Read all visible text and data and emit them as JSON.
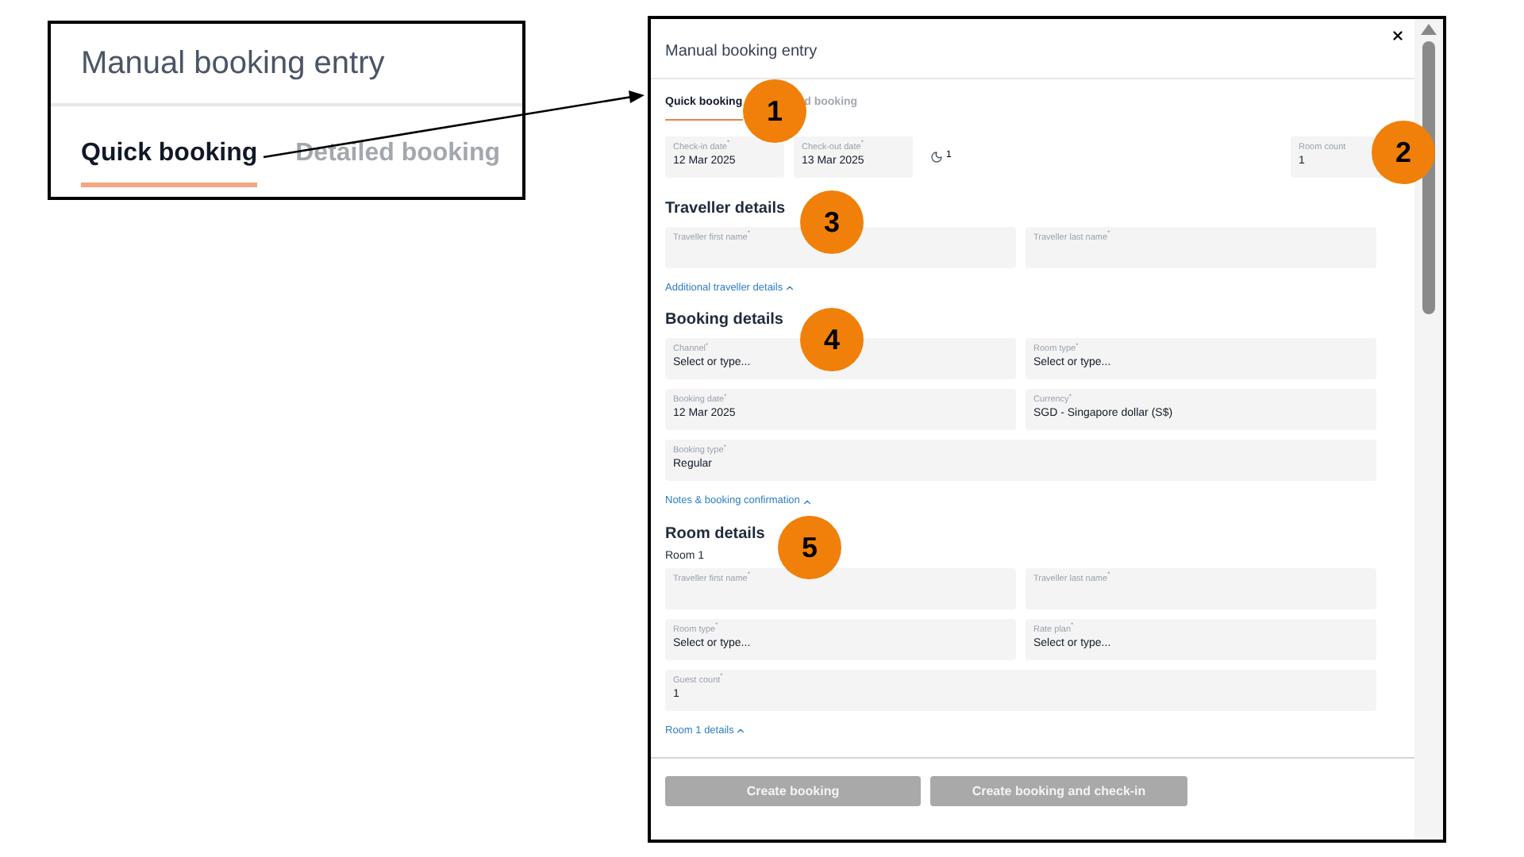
{
  "inset": {
    "title": "Manual booking entry",
    "tabs": [
      {
        "label": "Quick booking",
        "selected": true
      },
      {
        "label": "Detailed booking",
        "selected": false
      }
    ]
  },
  "dialog": {
    "title": "Manual booking entry",
    "tabs": [
      {
        "label": "Quick booking",
        "selected": true
      },
      {
        "label": "d booking",
        "selected": false
      }
    ],
    "stay_fields": [
      {
        "label": "Check-in date$^{*}$",
        "value": "12 Mar 2025"
      },
      {
        "label": "Check-out date$^{*}$",
        "value": "13 Mar 2025"
      }
    ],
    "nights": "1",
    "room_count": {
      "label": "Room count",
      "value": "1"
    },
    "sections": [
      {
        "heading": "Traveller details",
        "rows": [
          [
            {
              "label": "Traveller first name$^{*}$"
            },
            {
              "label": "Traveller last name$^{*}$"
            }
          ]
        ],
        "link": "Additional traveller details"
      },
      {
        "heading": "Booking details",
        "rows": [
          [
            {
              "label": "Channel$^{*}$",
              "value": "Select or type..."
            },
            {
              "label": "Room type$^{*}$",
              "value": "Select or type..."
            }
          ],
          [
            {
              "label": "Booking date$^{*}$",
              "value": "12 Mar 2025"
            },
            {
              "label": "Currency$^{*}$",
              "value": "SGD - Singapore dollar (S$)"
            }
          ],
          [
            {
              "label": "Booking type$^{*}$",
              "value": "Regular"
            }
          ]
        ],
        "link": "Notes & booking confirmation"
      },
      {
        "heading": "Room details",
        "subheading": "Room 1",
        "rows": [
          [
            {
              "label": "Traveller first name$^{*}$"
            },
            {
              "label": "Traveller last name$^{*}$"
            }
          ],
          [
            {
              "label": "Room type$^{*}$",
              "value": "Select or type..."
            },
            {
              "label": "Rate plan$^{*}$",
              "value": "Select or type..."
            }
          ],
          [
            {
              "label": "Guest count$^{*}$",
              "value": "1"
            }
          ]
        ],
        "link": "Room 1 details"
      }
    ],
    "buttons": [
      {
        "label": "Create booking",
        "disabled": true
      },
      {
        "label": "Create booking and check-in",
        "disabled": true
      }
    ]
  },
  "callouts": [
    "1",
    "2",
    "3",
    "4",
    "5"
  ]
}
